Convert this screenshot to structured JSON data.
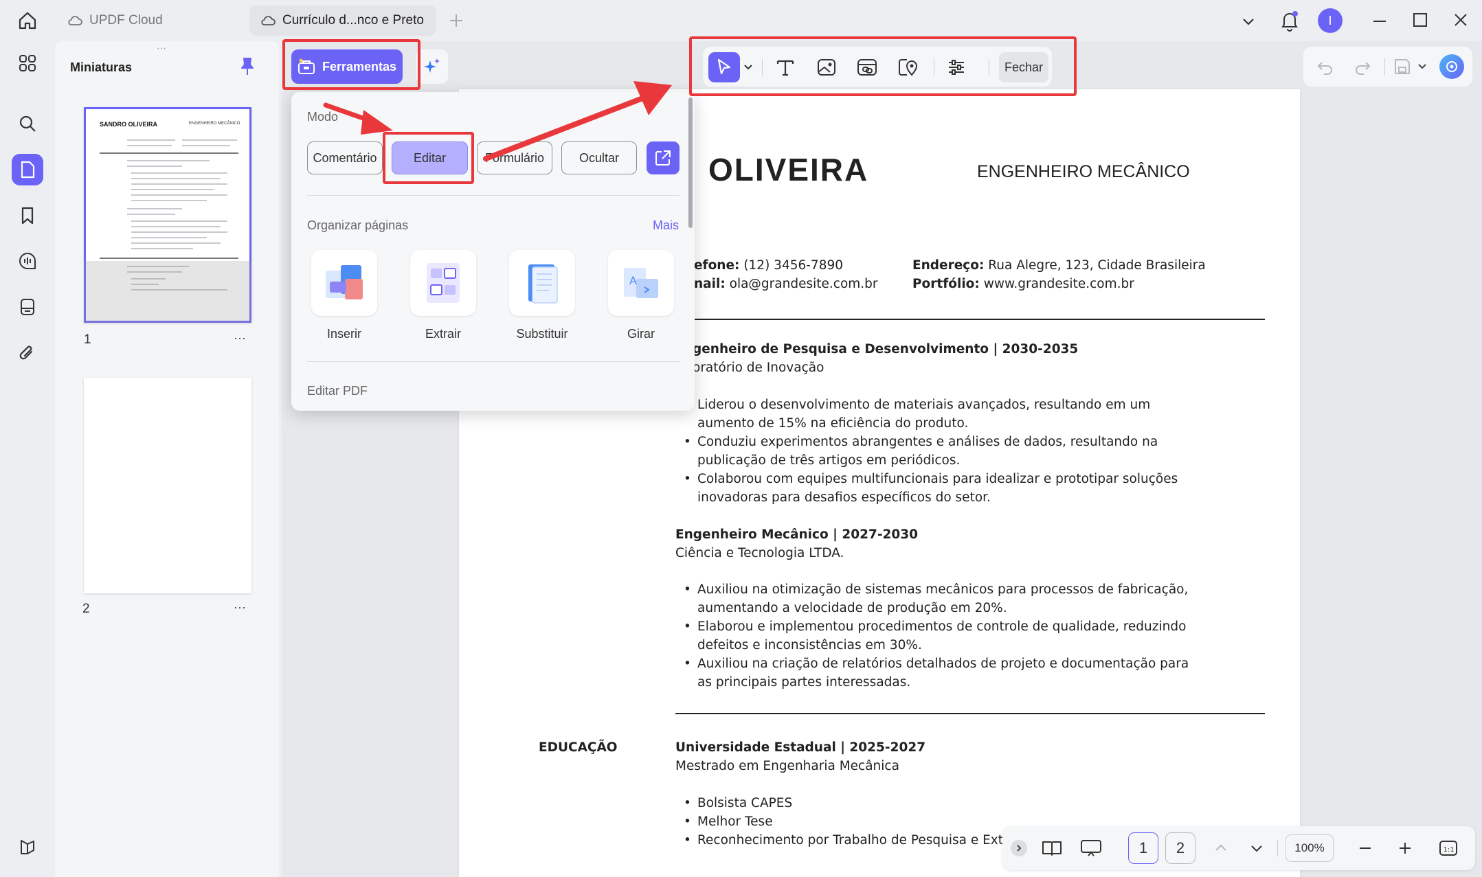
{
  "tabs": {
    "cloud_label": "UPDF Cloud",
    "document_label": "Currículo d...nco e Preto"
  },
  "user": {
    "avatar_initial": "I"
  },
  "thumbnails": {
    "title": "Miniaturas",
    "pages": [
      {
        "number": "1",
        "name_text": "SANDRO OLIVEIRA",
        "role_text": "ENGENHEIRO MECÂNICO"
      },
      {
        "number": "2"
      }
    ],
    "more_glyph": "···"
  },
  "tools": {
    "button_label": "Ferramentas",
    "menu": {
      "mode_heading": "Modo",
      "modes": [
        "Comentário",
        "Editar",
        "Formulário",
        "Ocultar"
      ],
      "active_mode": "Editar",
      "organize_heading": "Organizar páginas",
      "more_link": "Mais",
      "organize_items": [
        "Inserir",
        "Extrair",
        "Substituir",
        "Girar"
      ],
      "edit_pdf_heading": "Editar PDF"
    }
  },
  "edit_toolbar": {
    "close_label": "Fechar",
    "tools": [
      "select-icon",
      "text-icon",
      "image-icon",
      "link-icon",
      "location-icon",
      "properties-icon"
    ]
  },
  "document": {
    "surname": "OLIVEIRA",
    "role": "ENGENHEIRO MECÂNICO",
    "contacts": {
      "phone_label": "efone:",
      "phone_value": "(12) 3456-7890",
      "email_label": "nail:",
      "email_value": "ola@grandesite.com.br",
      "address_label": "Endereço:",
      "address_value": "Rua Alegre, 123, Cidade Brasileira",
      "portfolio_label": "Portfólio:",
      "portfolio_value": "www.grandesite.com.br"
    },
    "job1": {
      "title": "genheiro de Pesquisa e Desenvolvimento | 2030-2035",
      "company": "oratório de Inovação",
      "bullets": [
        [
          "Liderou o desenvolvimento de materiais avançados, resultando em um",
          "aumento de 15% na eficiência do produto."
        ],
        [
          "Conduziu experimentos abrangentes e análises de dados, resultando na",
          "publicação de três artigos em periódicos."
        ],
        [
          "Colaborou com equipes multifuncionais para idealizar e prototipar soluções",
          "inovadoras para desafios específicos do setor."
        ]
      ]
    },
    "job2": {
      "title": "Engenheiro Mecânico | 2027-2030",
      "company": "Ciência e Tecnologia LTDA.",
      "bullets": [
        [
          "Auxiliou na otimização de sistemas mecânicos para processos de fabricação,",
          "aumentando a velocidade de produção em 20%."
        ],
        [
          "Elaborou e implementou procedimentos de controle de qualidade, reduzindo",
          "defeitos e inconsistências em 30%."
        ],
        [
          "Auxiliou na criação de relatórios detalhados de projeto e documentação para",
          "as principais partes interessadas."
        ]
      ]
    },
    "education": {
      "section_label": "EDUCAÇÃO",
      "school": "Universidade Estadual | 2025-2027",
      "degree": "Mestrado em Engenharia Mecânica",
      "bullets": [
        "Bolsista CAPES",
        "Melhor Tese",
        "Reconhecimento por Trabalho de Pesquisa e Exten"
      ]
    }
  },
  "bottom_nav": {
    "pages": [
      "1",
      "2"
    ],
    "current_page": "1",
    "zoom": "100%"
  },
  "colors": {
    "accent": "#6b63f5",
    "annotation_red": "#e8383b",
    "active_mode_bg": "#b4b0ff"
  }
}
